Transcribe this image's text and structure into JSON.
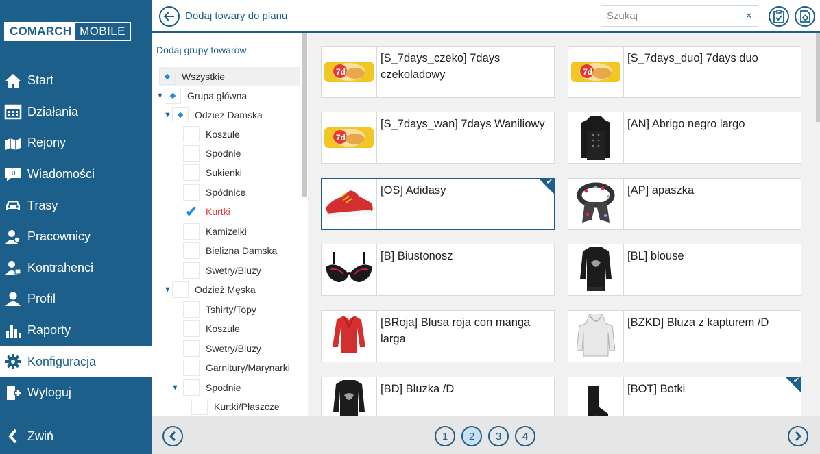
{
  "logo": {
    "part1": "COMARCH",
    "part2": "MOBILE"
  },
  "sidebar": {
    "items": [
      {
        "label": "Start",
        "icon": "home-icon"
      },
      {
        "label": "Działania",
        "icon": "calendar-icon"
      },
      {
        "label": "Rejony",
        "icon": "map-icon"
      },
      {
        "label": "Wiadomości",
        "icon": "message-icon",
        "badge": "0"
      },
      {
        "label": "Trasy",
        "icon": "car-icon"
      },
      {
        "label": "Pracownicy",
        "icon": "workers-icon"
      },
      {
        "label": "Kontrahenci",
        "icon": "contractors-icon"
      },
      {
        "label": "Profil",
        "icon": "profile-icon"
      },
      {
        "label": "Raporty",
        "icon": "chart-icon"
      },
      {
        "label": "Konfiguracja",
        "icon": "gear-icon",
        "active": true
      },
      {
        "label": "Wyloguj",
        "icon": "logout-icon"
      }
    ],
    "collapse_label": "Zwiń"
  },
  "header": {
    "title": "Dodaj towary do planu",
    "search_placeholder": "Szukaj",
    "clear": "×"
  },
  "tree": {
    "heading": "Dodaj grupy towarów",
    "rows": [
      {
        "label": "Wszystkie"
      },
      {
        "label": "Grupa główna"
      },
      {
        "label": "Odzież Damska"
      },
      {
        "label": "Koszule"
      },
      {
        "label": "Spodnie"
      },
      {
        "label": "Sukienki"
      },
      {
        "label": "Spódnice"
      },
      {
        "label": "Kurtki"
      },
      {
        "label": "Kamizelki"
      },
      {
        "label": "Bielizna Damska"
      },
      {
        "label": "Swetry/Bluzy"
      },
      {
        "label": "Odzież Męska"
      },
      {
        "label": "Tshirty/Topy"
      },
      {
        "label": "Koszule"
      },
      {
        "label": "Swetry/Bluzy"
      },
      {
        "label": "Garnitury/Marynarki"
      },
      {
        "label": "Spodnie"
      },
      {
        "label": "Kurtki/Płaszcze"
      }
    ]
  },
  "products": [
    {
      "name": "[S_7days_czeko] 7days czekoladowy",
      "image": "croissant-pack",
      "selected": false
    },
    {
      "name": "[S_7days_duo] 7days duo",
      "image": "croissant-pack",
      "selected": false
    },
    {
      "name": "[S_7days_wan] 7days Waniliowy",
      "image": "croissant-pack",
      "selected": false
    },
    {
      "name": "[AN] Abrigo negro largo",
      "image": "black-coat",
      "selected": false
    },
    {
      "name": "[OS] Adidasy",
      "image": "red-sneaker",
      "selected": true
    },
    {
      "name": "[AP] apaszka",
      "image": "scarf",
      "selected": false
    },
    {
      "name": "[B] Biustonosz",
      "image": "bra",
      "selected": false
    },
    {
      "name": "[BL] blouse",
      "image": "black-blouse",
      "selected": false
    },
    {
      "name": "[BRoja] Blusa roja con manga larga",
      "image": "red-blouse",
      "selected": false
    },
    {
      "name": "[BZKD] Bluza z kapturem /D",
      "image": "white-hoodie",
      "selected": false
    },
    {
      "name": "[BD] Bluzka /D",
      "image": "black-blouse",
      "selected": false
    },
    {
      "name": "[BOT] Botki",
      "image": "ankle-boot",
      "selected": true
    }
  ],
  "pagination": {
    "pages": [
      "1",
      "2",
      "3",
      "4"
    ],
    "current": "2"
  }
}
